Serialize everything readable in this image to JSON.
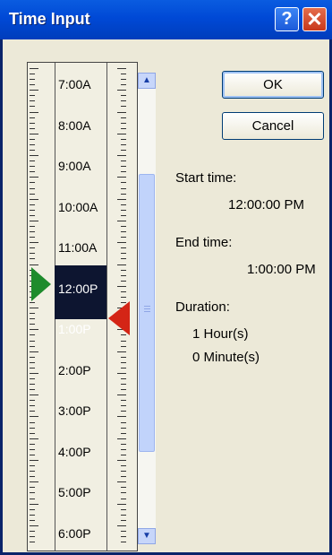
{
  "window": {
    "title": "Time Input",
    "help_glyph": "?",
    "close_glyph": "✕"
  },
  "timeline": {
    "hours": [
      "7:00A",
      "8:00A",
      "9:00A",
      "10:00A",
      "11:00A",
      "12:00P",
      "1:00P",
      "2:00P",
      "3:00P",
      "4:00P",
      "5:00P",
      "6:00P"
    ]
  },
  "buttons": {
    "ok": "OK",
    "cancel": "Cancel"
  },
  "info": {
    "start_label": "Start time:",
    "start_value": "12:00:00 PM",
    "end_label": "End time:",
    "end_value": "1:00:00 PM",
    "duration_label": "Duration:",
    "hours_value": "1 Hour(s)",
    "minutes_value": "0 Minute(s)"
  },
  "icons": {
    "scroll_up": "scroll-up-arrow-icon",
    "scroll_down": "scroll-down-arrow-icon",
    "start_marker": "green-triangle-icon",
    "end_marker": "red-triangle-icon"
  },
  "colors": {
    "title_bar": "#0049d6",
    "start_marker": "#1e8b2c",
    "end_marker": "#d42516",
    "selection": "#0d1530"
  }
}
